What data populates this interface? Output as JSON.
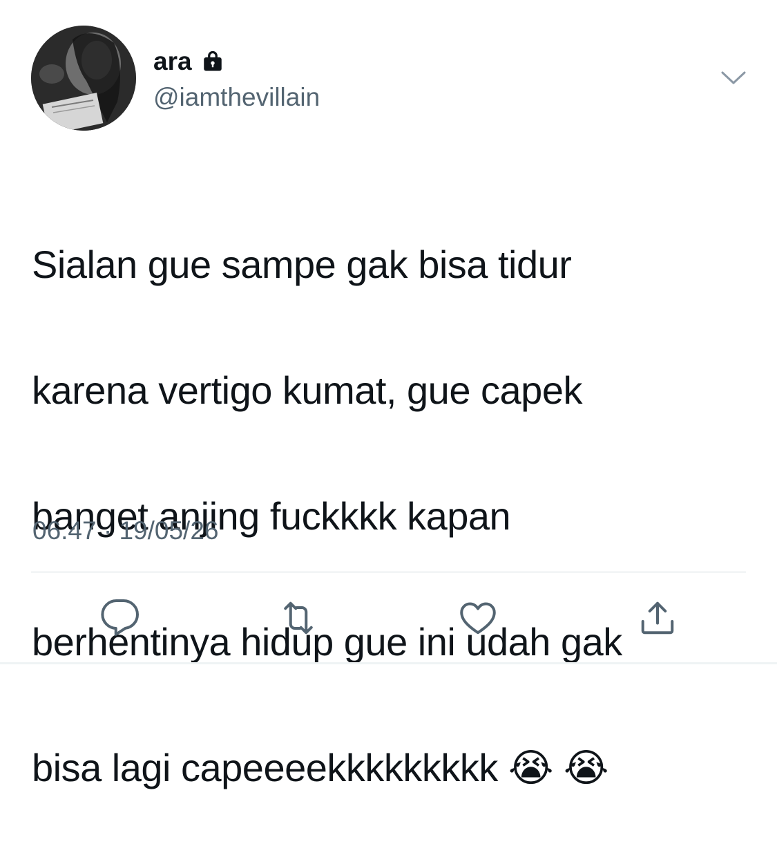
{
  "tweet": {
    "display_name": "ara",
    "handle": "@iamthevillain",
    "text_lines": [
      "Sialan gue sampe gak bisa tidur",
      "karena vertigo kumat, gue capek",
      "banget anjing fuckkkk kapan",
      "berhentinya hidup gue ini udah gak",
      "bisa lagi capeeeekkkkkkkkk 😭 😭"
    ],
    "timestamp": "06.47 · 19/05/26"
  },
  "icons": {
    "protected": "lock-icon",
    "menu": "chevron-down-icon",
    "reply": "reply-icon",
    "retweet": "retweet-icon",
    "like": "heart-icon",
    "share": "share-icon"
  },
  "colors": {
    "text_primary": "#0f1419",
    "text_secondary": "#536471",
    "divider": "#cfd9de",
    "icon": "#536471"
  }
}
